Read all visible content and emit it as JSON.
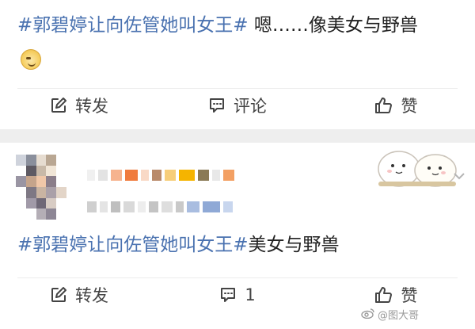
{
  "posts": [
    {
      "topic": "#郭碧婷让向佐管她叫女王#",
      "text": " 嗯……像美女与野兽",
      "actions": {
        "repost": "转发",
        "comment": "评论",
        "like": "赞"
      }
    },
    {
      "topic": "#郭碧婷让向佐管她叫女王#",
      "text": "美女与野兽",
      "actions": {
        "repost": "转发",
        "comment": "1",
        "like": "赞"
      }
    }
  ],
  "watermark": "@图大哥",
  "icons": {
    "repost": "edit-square-icon",
    "comment": "comment-bubble-icon",
    "like": "thumbs-up-icon",
    "more": "chevron-down-icon"
  },
  "colors": {
    "topic": "#4a72b0",
    "text": "#222222",
    "background": "#eeeeee",
    "card": "#ffffff"
  }
}
